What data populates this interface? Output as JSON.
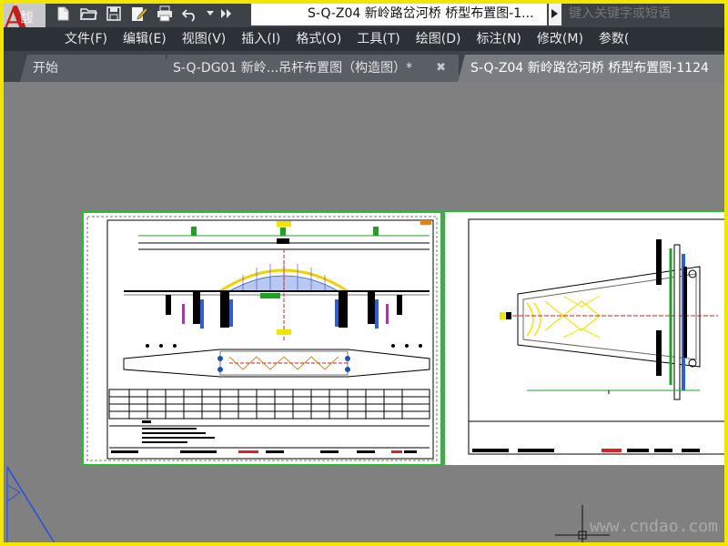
{
  "window": {
    "title": "S-Q-Z04 新岭路岔河桥 桥型布置图-1...",
    "search_placeholder": "键入关键字或短语",
    "logo_letter": "A",
    "logo_watermark": "馥龙网"
  },
  "quick_access": {
    "icons": [
      "new-file-icon",
      "open-folder-icon",
      "save-icon",
      "edit-document-icon",
      "print-icon",
      "undo-icon",
      "dropdown-arrow-icon",
      "more-icon"
    ]
  },
  "menu": {
    "items": [
      "文件(F)",
      "编辑(E)",
      "视图(V)",
      "插入(I)",
      "格式(O)",
      "工具(T)",
      "绘图(D)",
      "标注(N)",
      "修改(M)",
      "参数("
    ]
  },
  "tabs": [
    {
      "label": "开始",
      "active": false
    },
    {
      "label": "S-Q-DG01 新岭...吊杆布置图（构造图）*",
      "active": false,
      "close": "✖"
    },
    {
      "label": "S-Q-Z04 新岭路岔河桥 桥型布置图-1124",
      "active": true
    }
  ],
  "watermark": "www.cndao.com",
  "colors": {
    "titlebar": "#3d4148",
    "menubar": "#2c3037",
    "tabbar": "#3f434a",
    "canvas": "#808080",
    "viewport_border": "#22c02a",
    "highlight_frame": "#f2e600",
    "logo_red": "#c0201a"
  }
}
